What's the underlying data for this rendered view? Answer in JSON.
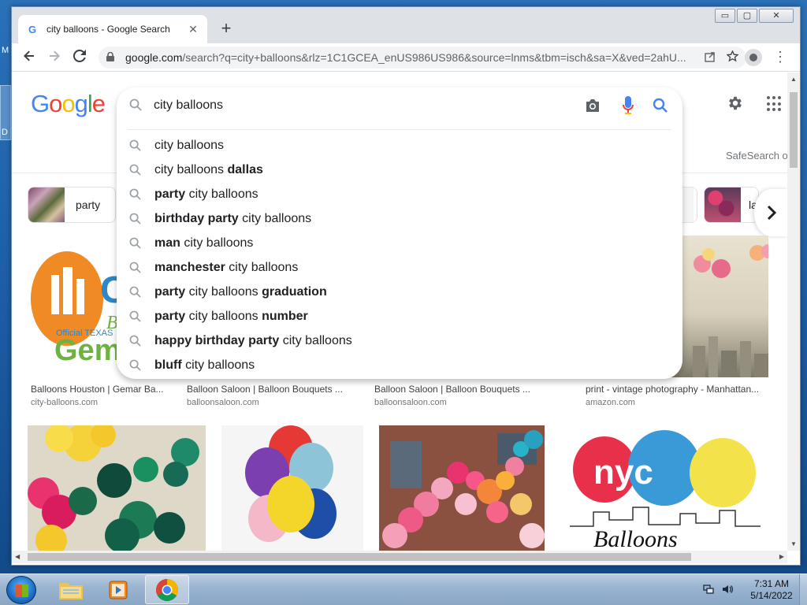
{
  "desktop": {
    "icon_label_top": "M",
    "icon_label_bottom": "D"
  },
  "browser": {
    "tab_title": "city balloons - Google Search",
    "tab_favicon": "G",
    "tab_close": "✕",
    "new_tab": "+",
    "url_host": "google.com",
    "url_rest": "/search?q=city+balloons&rlz=1C1GCEA_enUS986US986&source=lnms&tbm=isch&sa=X&ved=2ahU..."
  },
  "window_controls": {
    "minimize": "▭",
    "maximize": "▢",
    "close": "✕"
  },
  "google": {
    "logo_letters": [
      "G",
      "o",
      "o",
      "g",
      "l",
      "e"
    ],
    "search_query": "city balloons",
    "safesearch": "SafeSearch o"
  },
  "suggestions": [
    {
      "parts": [
        {
          "t": "city balloons",
          "b": false
        }
      ]
    },
    {
      "parts": [
        {
          "t": "city balloons ",
          "b": false
        },
        {
          "t": "dallas",
          "b": true
        }
      ]
    },
    {
      "parts": [
        {
          "t": "party",
          "b": true
        },
        {
          "t": " city balloons",
          "b": false
        }
      ]
    },
    {
      "parts": [
        {
          "t": "birthday party",
          "b": true
        },
        {
          "t": " city balloons",
          "b": false
        }
      ]
    },
    {
      "parts": [
        {
          "t": "man",
          "b": true
        },
        {
          "t": " city balloons",
          "b": false
        }
      ]
    },
    {
      "parts": [
        {
          "t": "manchester",
          "b": true
        },
        {
          "t": " city balloons",
          "b": false
        }
      ]
    },
    {
      "parts": [
        {
          "t": "party",
          "b": true
        },
        {
          "t": " city balloons ",
          "b": false
        },
        {
          "t": "graduation",
          "b": true
        }
      ]
    },
    {
      "parts": [
        {
          "t": "party",
          "b": true
        },
        {
          "t": " city balloons ",
          "b": false
        },
        {
          "t": "number",
          "b": true
        }
      ]
    },
    {
      "parts": [
        {
          "t": "happy birthday party",
          "b": true
        },
        {
          "t": " city balloons",
          "b": false
        }
      ]
    },
    {
      "parts": [
        {
          "t": "bluff",
          "b": true
        },
        {
          "t": " city balloons",
          "b": false
        }
      ]
    }
  ],
  "chips": [
    {
      "label": "party"
    },
    {
      "label": "la"
    }
  ],
  "results_row1": [
    {
      "title": "Balloons Houston | Gemar Ba...",
      "source": "city-balloons.com"
    },
    {
      "title": "Balloon Saloon | Balloon Bouquets ...",
      "source": "balloonsaloon.com"
    },
    {
      "title": "Balloon Saloon | Balloon Bouquets ...",
      "source": "balloonsaloon.com"
    },
    {
      "title": "print - vintage photography - Manhattan...",
      "source": "amazon.com"
    }
  ],
  "result_image_text": {
    "logo_cl": "Cl",
    "logo_ba": "Ba",
    "logo_official": "Official TEXAS",
    "logo_gem": "Gem",
    "nyc": "nyc",
    "nyc_script": "Balloons"
  },
  "taskbar": {
    "time": "7:31 AM",
    "date": "5/14/2022"
  },
  "colors": {
    "google_blue": "#4285f4",
    "google_red": "#ea4335",
    "google_yellow": "#fbbc05",
    "google_green": "#34a853"
  }
}
